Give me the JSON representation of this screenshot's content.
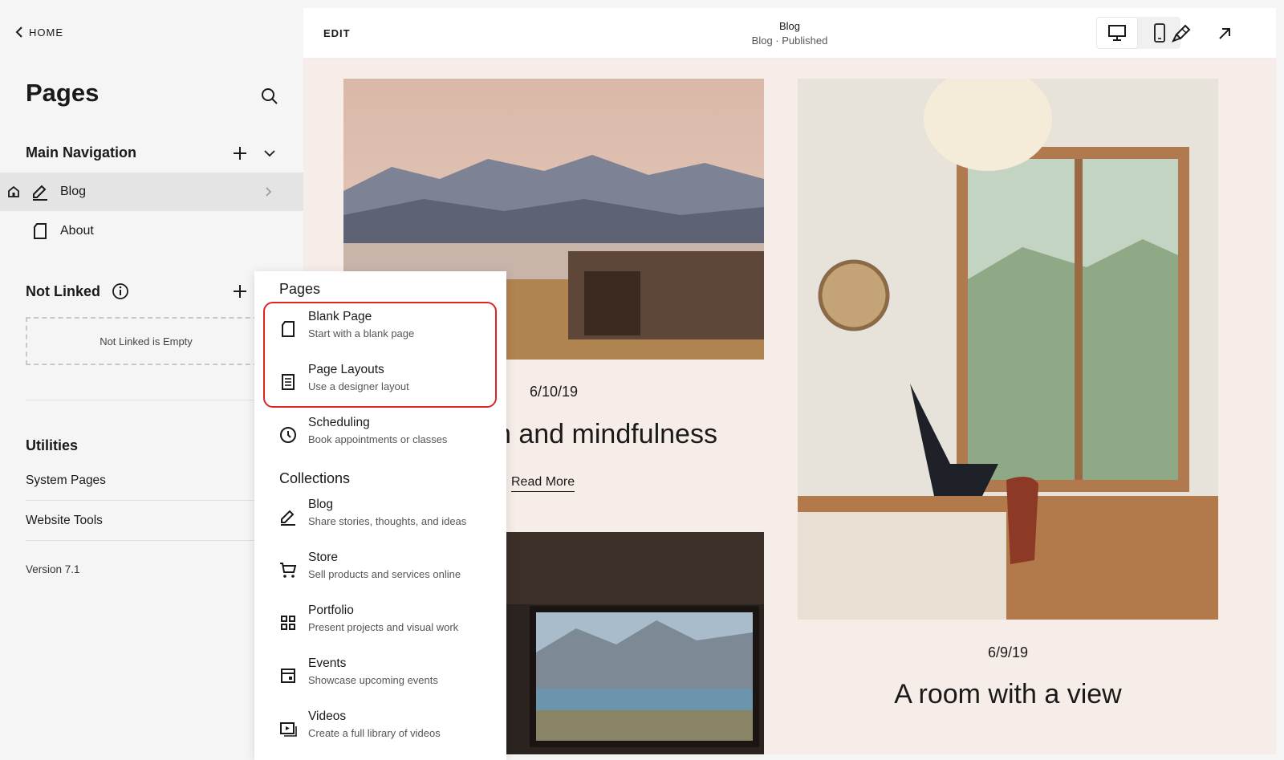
{
  "sidebar": {
    "home_label": "HOME",
    "title": "Pages",
    "main_navigation": {
      "label": "Main Navigation",
      "items": [
        {
          "label": "Blog",
          "icon": "blog-edit-icon",
          "active": true,
          "is_homepage": true
        },
        {
          "label": "About",
          "icon": "page-icon",
          "active": false
        }
      ]
    },
    "not_linked": {
      "label": "Not Linked",
      "empty_text": "Not Linked is Empty"
    },
    "utilities": {
      "label": "Utilities",
      "items": [
        "System Pages",
        "Website Tools"
      ]
    },
    "version": "Version 7.1"
  },
  "topbar": {
    "edit_label": "EDIT",
    "title": "Blog",
    "subtitle": "Blog · Published"
  },
  "posts": [
    {
      "date": "6/10/19",
      "title_visible": "n and mindfulness",
      "read_more": "Read More"
    },
    {
      "date": "6/9/19",
      "title": "A room with a view"
    }
  ],
  "dropdown": {
    "pages_heading": "Pages",
    "pages": [
      {
        "title": "Blank Page",
        "subtitle": "Start with a blank page",
        "icon": "blank-page-icon"
      },
      {
        "title": "Page Layouts",
        "subtitle": "Use a designer layout",
        "icon": "layout-icon"
      },
      {
        "title": "Scheduling",
        "subtitle": "Book appointments or classes",
        "icon": "clock-icon"
      }
    ],
    "collections_heading": "Collections",
    "collections": [
      {
        "title": "Blog",
        "subtitle": "Share stories, thoughts, and ideas",
        "icon": "blog-edit-icon"
      },
      {
        "title": "Store",
        "subtitle": "Sell products and services online",
        "icon": "cart-icon"
      },
      {
        "title": "Portfolio",
        "subtitle": "Present projects and visual work",
        "icon": "grid-icon"
      },
      {
        "title": "Events",
        "subtitle": "Showcase upcoming events",
        "icon": "calendar-icon"
      },
      {
        "title": "Videos",
        "subtitle": "Create a full library of videos",
        "icon": "video-icon"
      }
    ]
  },
  "colors": {
    "highlight": "#e02424",
    "canvas_bg": "#f6ece8",
    "active_row": "#e4e4e4"
  }
}
